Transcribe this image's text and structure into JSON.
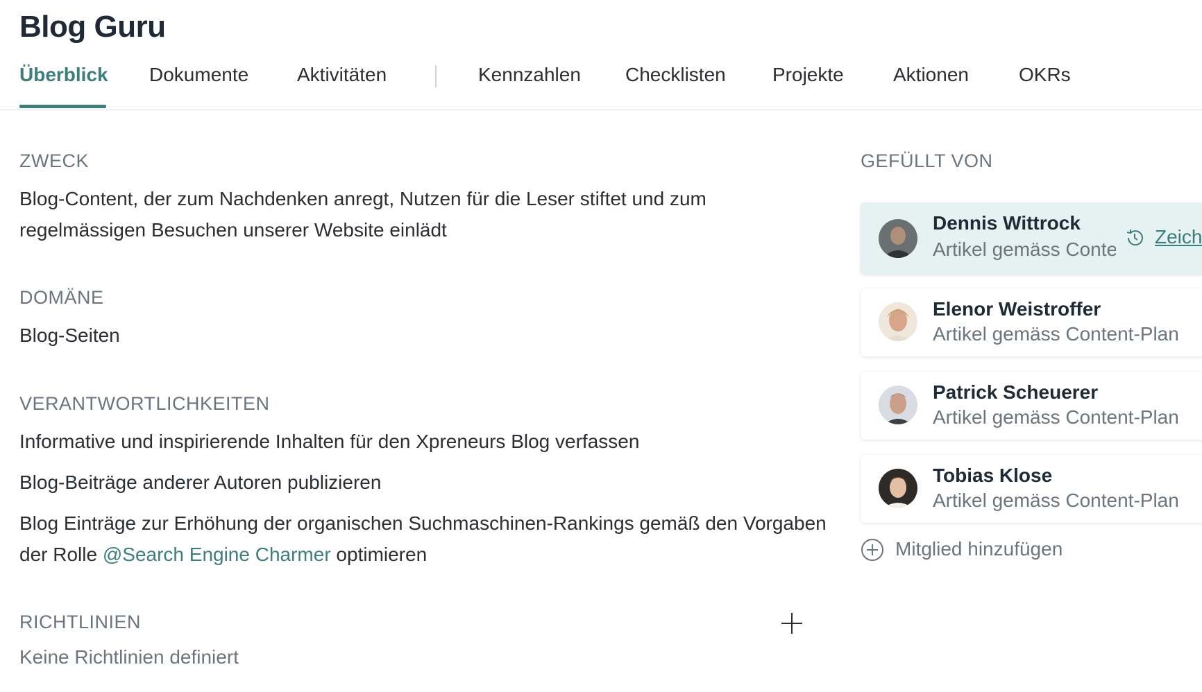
{
  "page": {
    "title": "Blog Guru"
  },
  "tabs": [
    {
      "label": "Überblick",
      "active": true
    },
    {
      "label": "Dokumente"
    },
    {
      "label": "Aktivitäten"
    },
    {
      "label": "Kennzahlen"
    },
    {
      "label": "Checklisten"
    },
    {
      "label": "Projekte"
    },
    {
      "label": "Aktionen"
    },
    {
      "label": "OKRs"
    }
  ],
  "purpose": {
    "label": "ZWECK",
    "line1": "Blog-Content, der zum Nachdenken anregt, Nutzen für die Leser stiftet und zum",
    "line2": "regelmässigen Besuchen unserer Website einlädt"
  },
  "domain": {
    "label": "DOMÄNE",
    "value": "Blog-Seiten"
  },
  "responsibilities": {
    "label": "VERANTWORTLICHKEITEN",
    "item1": "Informative und inspirierende Inhalten für den Xpreneurs Blog verfassen",
    "item2": "Blog-Beiträge anderer Autoren publizieren",
    "item3_line1": "Blog Einträge zur Erhöhung der organischen Suchmaschinen-Rankings gemäß den Vorgaben",
    "item3_prefix": "der Rolle ",
    "item3_mention": "@Search Engine Charmer",
    "item3_suffix": " optimieren"
  },
  "guidelines": {
    "label": "RICHTLINIEN",
    "empty": "Keine Richtlinien definiert"
  },
  "filled_by": {
    "label": "GEFÜLLT VON",
    "members": [
      {
        "name": "Dennis Wittrock",
        "role": "Artikel gemäss Content-Plan",
        "link": "Zeich"
      },
      {
        "name": "Elenor Weistroffer",
        "role": "Artikel gemäss Content-Plan"
      },
      {
        "name": "Patrick Scheuerer",
        "role": "Artikel gemäss Content-Plan"
      },
      {
        "name": "Tobias Klose",
        "role": "Artikel gemäss Content-Plan"
      }
    ],
    "add_label": "Mitglied hinzufügen"
  },
  "colors": {
    "accent": "#3d7d7c",
    "muted": "#6c757d",
    "highlight": "#e6f2f2"
  },
  "icons": [
    "plus-icon",
    "history-icon",
    "add-circle-icon"
  ]
}
